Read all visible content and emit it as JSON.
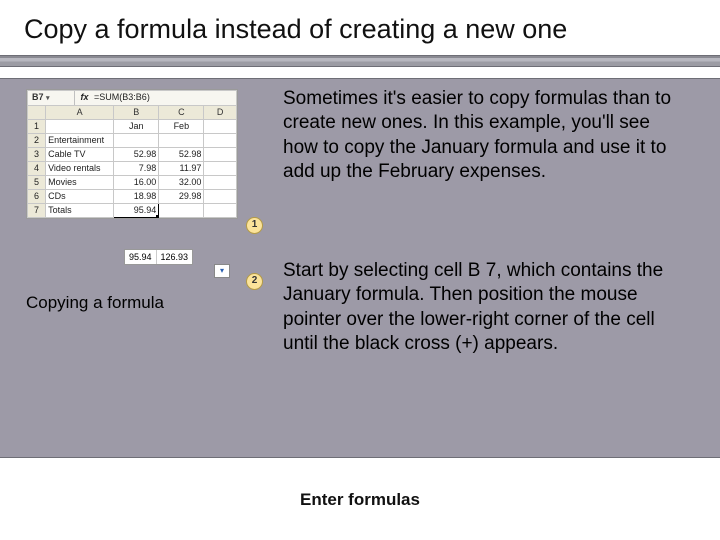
{
  "slide": {
    "title": "Copy a formula instead of creating a new one",
    "caption": "Copying a formula",
    "para1": "Sometimes it's easier to copy formulas than to create new ones. In this example, you'll see how to copy the January formula and use it to add up the February expenses.",
    "para2": "Start by selecting cell B 7, which contains the January formula. Then position the mouse pointer over the lower-right corner of the cell until the black cross (+) appears.",
    "footer": "Enter formulas"
  },
  "sheet": {
    "namebox": "B7",
    "fx_prefix": "fx",
    "formula": "=SUM(B3:B6)",
    "col_headers": [
      "",
      "A",
      "B",
      "C",
      "D"
    ],
    "rows": [
      {
        "n": "1",
        "a": "",
        "b": "Jan",
        "c": "Feb",
        "d": ""
      },
      {
        "n": "2",
        "a": "Entertainment",
        "b": "",
        "c": "",
        "d": ""
      },
      {
        "n": "3",
        "a": "Cable TV",
        "b": "52.98",
        "c": "52.98",
        "d": ""
      },
      {
        "n": "4",
        "a": "Video rentals",
        "b": "7.98",
        "c": "11.97",
        "d": ""
      },
      {
        "n": "5",
        "a": "Movies",
        "b": "16.00",
        "c": "32.00",
        "d": ""
      },
      {
        "n": "6",
        "a": "CDs",
        "b": "18.98",
        "c": "29.98",
        "d": ""
      },
      {
        "n": "7",
        "a": "Totals",
        "b": "95.94",
        "c": "",
        "d": ""
      }
    ],
    "float_values": [
      "95.94",
      "126.93"
    ],
    "tag_glyph": "▾"
  },
  "callouts": {
    "c1": "1",
    "c2": "2"
  }
}
